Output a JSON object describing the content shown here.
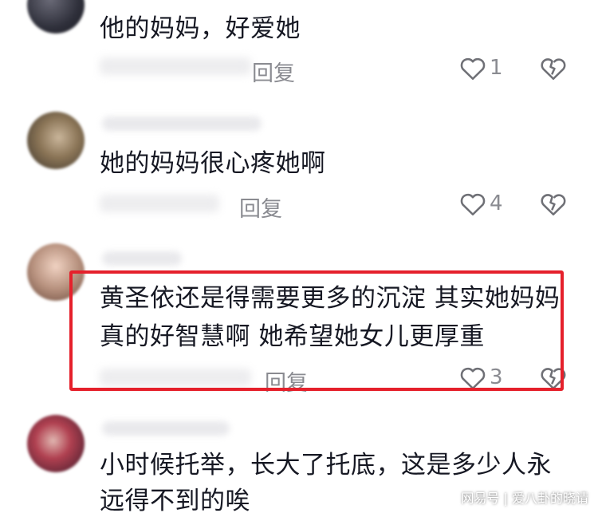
{
  "comments": [
    {
      "text": "他的妈妈，好爱她",
      "reply_label": "回复",
      "like_count": "1"
    },
    {
      "text": "她的妈妈很心疼她啊",
      "reply_label": "回复",
      "like_count": "4"
    },
    {
      "text_line1": "黄圣依还是得需要更多的沉淀 其实她妈妈",
      "text_line2": "真的好智慧啊 她希望她女儿更厚重",
      "reply_label": "回复",
      "like_count": "3",
      "highlighted": true
    },
    {
      "text_line1": "小时候托举，长大了托底，这是多少人永",
      "text_line2": "远得不到的唉"
    }
  ],
  "watermark": "网易号 | 爱八卦的晓请",
  "colors": {
    "highlight": "#e5202b",
    "text": "#161823",
    "muted": "#8a8b91"
  },
  "icons": {
    "like": "heart-outline-icon",
    "dislike": "broken-heart-icon"
  }
}
